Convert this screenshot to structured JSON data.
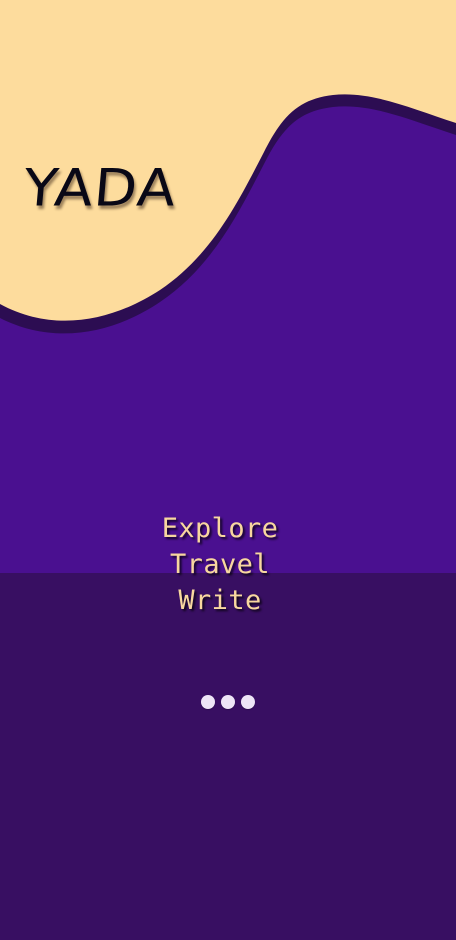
{
  "app": {
    "name": "YADA"
  },
  "splash": {
    "tagline": [
      "Explore",
      "Travel",
      "Write"
    ],
    "loading_indicator": {
      "dot_count": 3
    }
  },
  "colors": {
    "cream": "#fddc9d",
    "purple": "#4a1090",
    "dark_purple": "#380f62",
    "wave_outline": "#2c0d52",
    "brand_text": "#090816",
    "tagline_text": "#f8d79f",
    "loader_dots": "#eee6f7"
  }
}
